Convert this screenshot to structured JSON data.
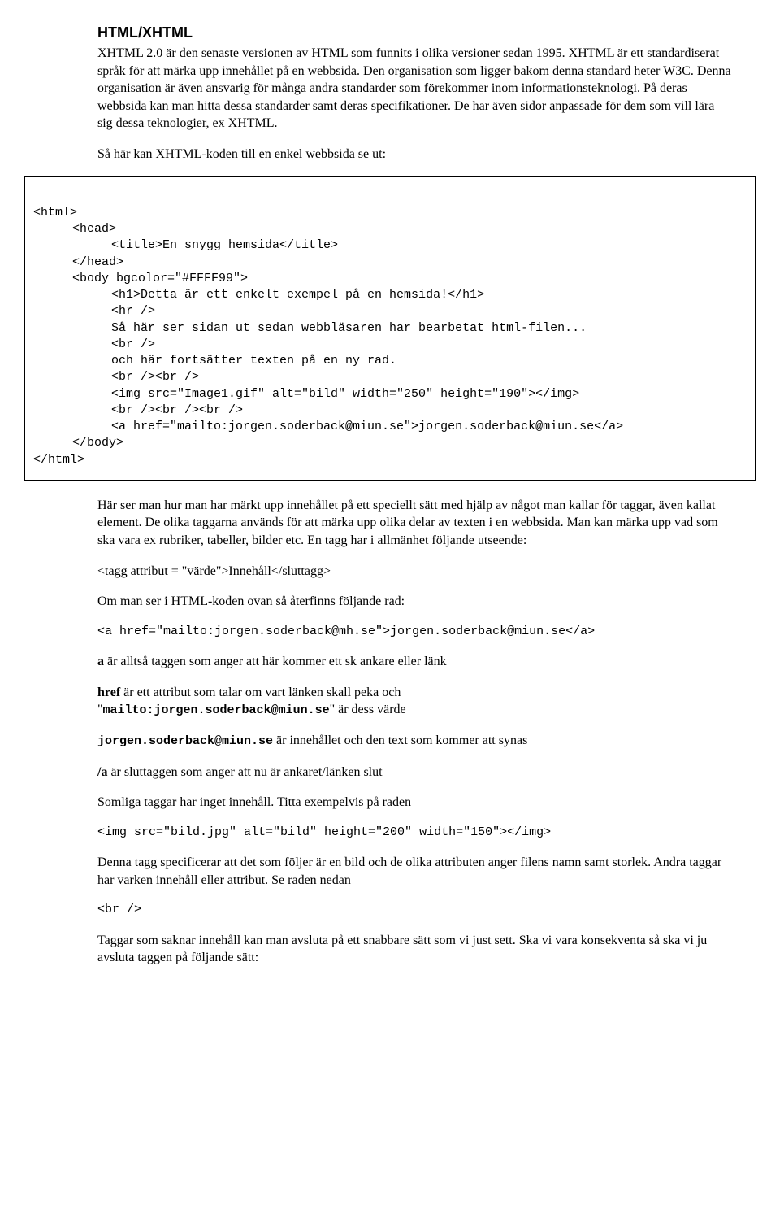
{
  "section": {
    "title": "HTML/XHTML",
    "p1": "XHTML 2.0 är den senaste versionen av HTML som funnits i olika versioner sedan 1995. XHTML är ett standardiserat språk för att märka upp innehållet på en webbsida. Den organisation som ligger bakom denna standard heter W3C. Denna organisation är även ansvarig för många andra standarder som förekommer inom informationsteknologi. På deras webbsida kan man hitta dessa standarder samt deras specifikationer. De har även sidor anpassade för dem som vill lära sig dessa teknologier, ex XHTML.",
    "p2": "Så här kan XHTML-koden till en enkel webbsida se ut:"
  },
  "code1": {
    "l1": "<html>",
    "l2": "<head>",
    "l3": "<title>En snygg hemsida</title>",
    "l4": "</head>",
    "l5": "<body bgcolor=\"#FFFF99\">",
    "l6": "<h1>Detta är ett enkelt exempel på en hemsida!</h1>",
    "l7": "<hr />",
    "l8": "Så här ser sidan ut sedan webbläsaren har bearbetat html-filen...",
    "l9": "<br />",
    "l10": "och här fortsätter texten på en ny rad.",
    "l11": "<br /><br />",
    "l12": "<img src=\"Image1.gif\" alt=\"bild\" width=\"250\" height=\"190\"></img>",
    "l13": "<br /><br /><br />",
    "l14": "<a href=\"mailto:jorgen.soderback@miun.se\">jorgen.soderback@miun.se</a>",
    "l15": "</body>",
    "l16": "</html>"
  },
  "after": {
    "p1": "Här ser man hur man har märkt upp innehållet på ett speciellt sätt med hjälp av något man kallar för taggar, även kallat element. De olika taggarna används för att märka upp olika delar av texten i en webbsida. Man kan märka upp vad som ska vara ex rubriker, tabeller, bilder etc. En tagg har i allmänhet följande utseende:",
    "tagsyntax": "<tagg attribut = \"värde\">Innehåll</sluttagg>",
    "p2": "Om man ser i HTML-koden ovan så återfinns följande rad:",
    "codeline1": "<a href=\"mailto:jorgen.soderback@mh.se\">jorgen.soderback@miun.se</a>",
    "p3_strong": "a",
    "p3_rest": " är alltså taggen som anger att här kommer ett sk ankare eller länk",
    "p4_strong": "href",
    "p4_a": " är ett attribut som talar om vart länken skall peka och",
    "p4_quote_open": "\"",
    "p4_code": "mailto:jorgen.soderback@miun.se",
    "p4_quote_close": "\" är dess värde",
    "p5_code": "jorgen.soderback@miun.se",
    "p5_rest": " är innehållet och den text som kommer att synas",
    "p6_strong": "/a",
    "p6_rest": " är sluttaggen som anger att nu är ankaret/länken slut",
    "p7": "Somliga taggar har inget innehåll. Titta exempelvis på raden",
    "codeline2": "<img src=\"bild.jpg\" alt=\"bild\" height=\"200\" width=\"150\"></img>",
    "p8": "Denna tagg specificerar att det som följer är en bild och de olika attributen anger filens namn samt storlek. Andra taggar har varken innehåll eller attribut. Se raden nedan",
    "codeline3": "<br />",
    "p9": "Taggar som saknar innehåll kan man avsluta på ett snabbare sätt som vi just sett. Ska vi vara konsekventa så ska vi ju avsluta taggen på följande sätt:"
  }
}
